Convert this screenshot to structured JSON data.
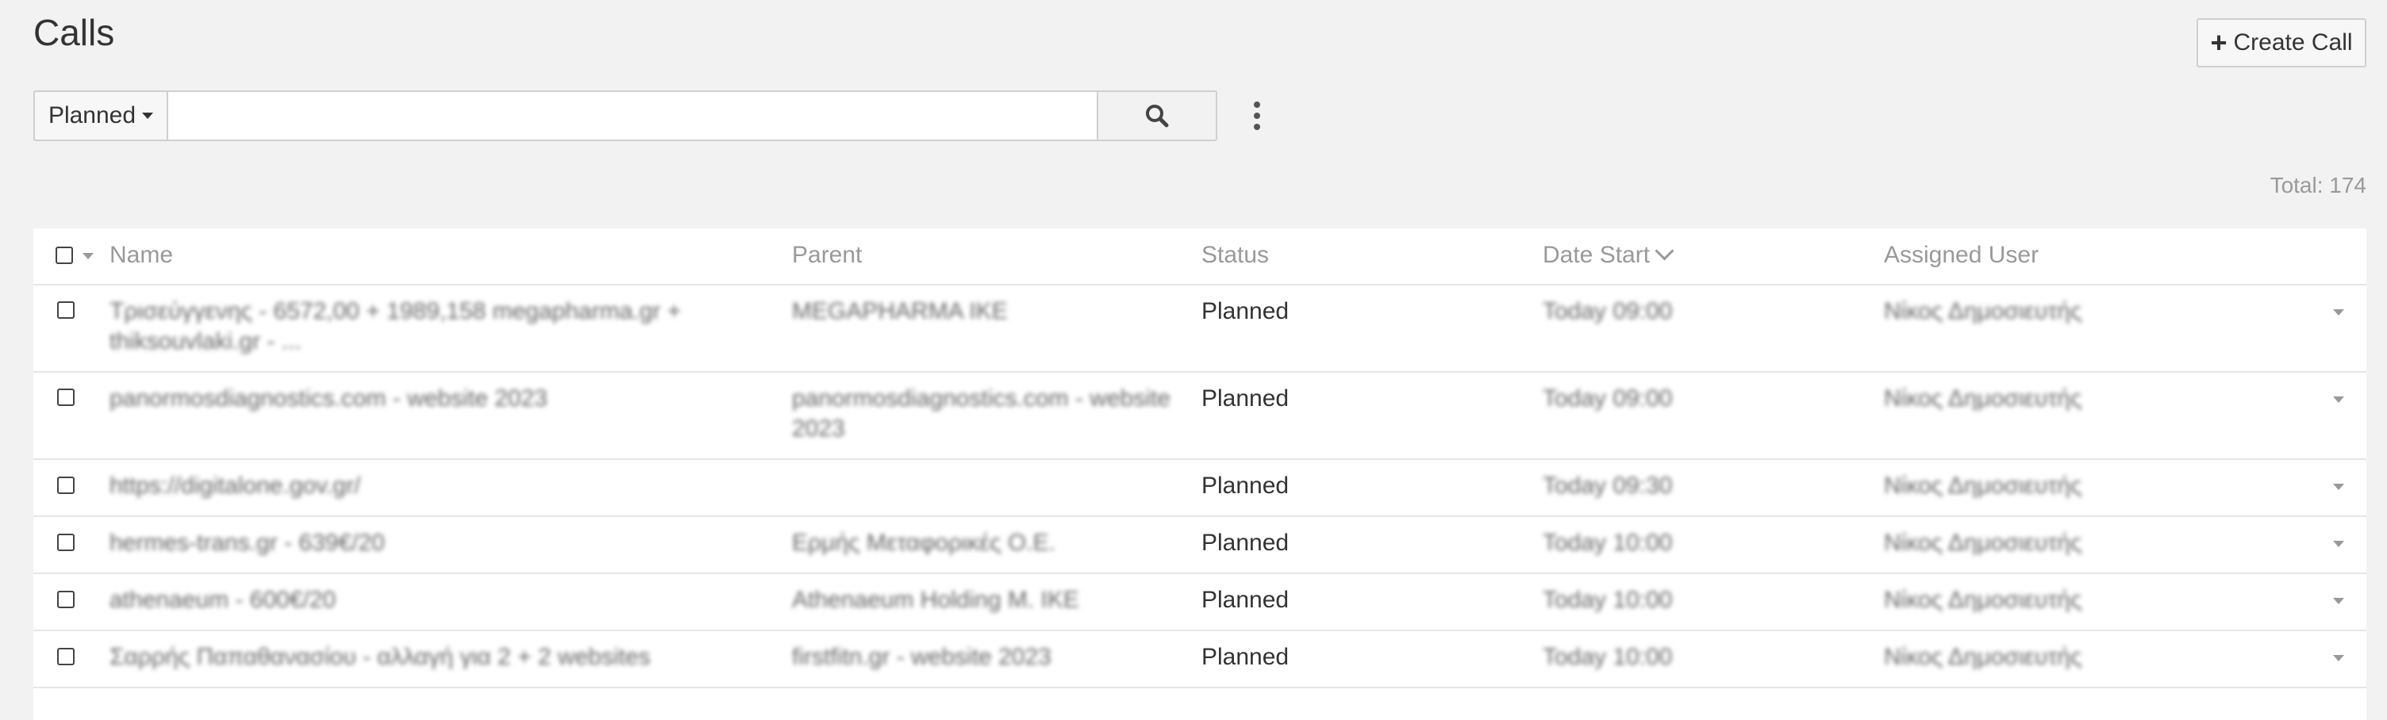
{
  "page": {
    "title": "Calls"
  },
  "toolbar": {
    "create_label": "Create Call"
  },
  "search": {
    "filter_label": "Planned",
    "value": "",
    "placeholder": ""
  },
  "summary": {
    "total_label": "Total: 174"
  },
  "table": {
    "columns": {
      "name": "Name",
      "parent": "Parent",
      "status": "Status",
      "date_start": "Date Start",
      "assigned_user": "Assigned User"
    },
    "rows": [
      {
        "name": "Τρισεύγγενης - 6572,00 + 1989,158 megapharma.gr +",
        "name2": "thiksouvlaki.gr - ...",
        "parent": "MEGAPHARMA IKE",
        "parent2": "",
        "status": "Planned",
        "date": "Today 09:00",
        "user": "Νίκος Δημοσιευτής"
      },
      {
        "name": "panormosdiagnostics.com - website 2023",
        "name2": "",
        "parent": "panormosdiagnostics.com - website",
        "parent2": "2023",
        "status": "Planned",
        "date": "Today 09:00",
        "user": "Νίκος Δημοσιευτής"
      },
      {
        "name": "https://digitalone.gov.gr/",
        "name2": "",
        "parent": "",
        "parent2": "",
        "status": "Planned",
        "date": "Today 09:30",
        "user": "Νίκος Δημοσιευτής"
      },
      {
        "name": "hermes-trans.gr - 639€/20",
        "name2": "",
        "parent": "Ερμής Μεταφορικές Ο.Ε.",
        "parent2": "",
        "status": "Planned",
        "date": "Today 10:00",
        "user": "Νίκος Δημοσιευτής"
      },
      {
        "name": "athenaeum - 600€/20",
        "name2": "",
        "parent": "Athenaeum Holding M. ΙΚΕ",
        "parent2": "",
        "status": "Planned",
        "date": "Today 10:00",
        "user": "Νίκος Δημοσιευτής"
      },
      {
        "name": "Σαρρής Παπαθανασίου - αλλαγή για 2 + 2 websites",
        "name2": "",
        "parent": "firstfitn.gr - website 2023",
        "parent2": "",
        "status": "Planned",
        "date": "Today 10:00",
        "user": "Νίκος Δημοσιευτής"
      }
    ]
  }
}
